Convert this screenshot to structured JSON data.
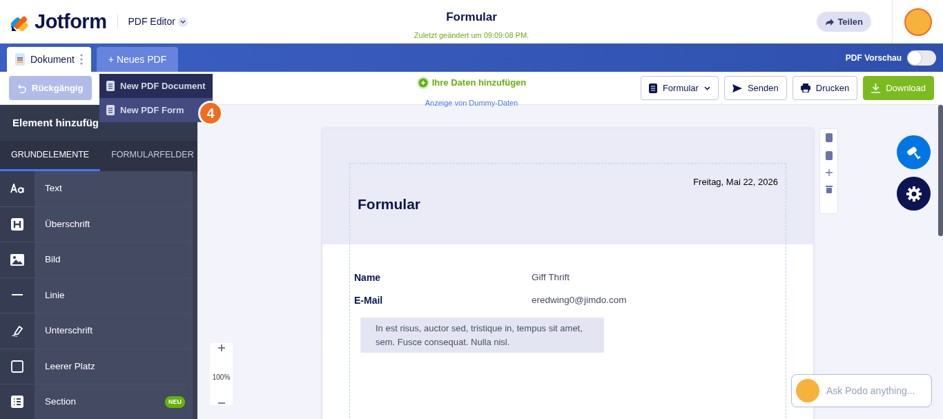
{
  "header": {
    "brand": "Jotform",
    "product": "PDF Editor",
    "title": "Formular",
    "subtitle": "Zuletzt geändert um 09:09:08 PM.",
    "share": "Teilen"
  },
  "tabs": [
    {
      "label": "Dokument",
      "selected": true
    },
    {
      "label": "+ Neues PDF",
      "selected": false
    }
  ],
  "preview": {
    "label": "PDF Vorschau",
    "on": false
  },
  "toolbar": {
    "undo": {
      "label": "Rückgängig",
      "disabled": true
    },
    "data_link": "Ihre Daten hinzufügen",
    "data_hint": "Anzeige von Dummy-Daten",
    "buttons": [
      {
        "label": "Formular",
        "kind": "dropdown"
      },
      {
        "label": "Senden",
        "kind": "send"
      },
      {
        "label": "Drucken",
        "kind": "print"
      },
      {
        "label": "Download",
        "kind": "download"
      }
    ]
  },
  "menu": {
    "items": [
      {
        "label": "New PDF Document",
        "selected": false
      },
      {
        "label": "New PDF Form",
        "selected": true
      }
    ],
    "step": "4"
  },
  "sidebar": {
    "title": "Element hinzufüg",
    "tabs": [
      {
        "label": "GRUNDELEMENTE",
        "selected": true
      },
      {
        "label": "FORMULARFELDER",
        "selected": false
      }
    ],
    "items": [
      {
        "label": "Text",
        "kind": "text"
      },
      {
        "label": "Überschrift",
        "kind": "heading"
      },
      {
        "label": "Bild",
        "kind": "image"
      },
      {
        "label": "Linie",
        "kind": "line"
      },
      {
        "label": "Unterschrift",
        "kind": "signature"
      },
      {
        "label": "Leerer Platz",
        "kind": "space"
      },
      {
        "label": "Section",
        "kind": "section",
        "badge": "NEU"
      }
    ]
  },
  "document": {
    "date": "Freitag, Mai 22, 2026",
    "title": "Formular",
    "fields": [
      {
        "label": "Name",
        "value": "Giff Thrift"
      },
      {
        "label": "E-Mail",
        "value": "eredwing0@jimdo.com"
      }
    ],
    "note": "In est risus, auctor sed, tristique in, tempus sit amet, sem. Fusce consequat. Nulla nisl."
  },
  "zoom": "100%",
  "chat": {
    "placeholder": "Ask Podo anything..."
  }
}
